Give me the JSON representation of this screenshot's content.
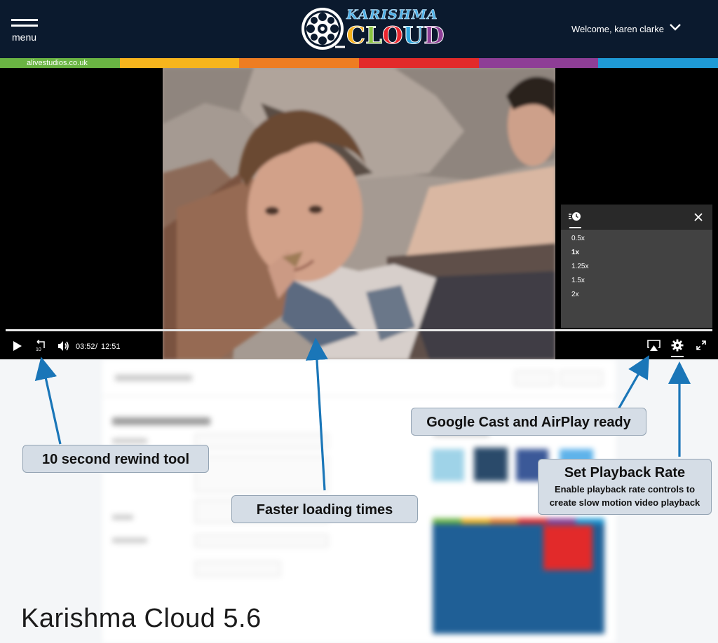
{
  "header": {
    "menu_label": "menu",
    "logo_top": "KARISHMA",
    "logo_bottom": [
      "C",
      "L",
      "O",
      "U",
      "D"
    ],
    "welcome": "Welcome, karen clarke",
    "bg_color": "#0b1a2e"
  },
  "strip": {
    "link": "alivestudios.co.uk",
    "colors": [
      "#6ab443",
      "#f7b51d",
      "#ee7d22",
      "#e22a2a",
      "#8e3e96",
      "#1f9ad6"
    ]
  },
  "player": {
    "current_time": "03:52",
    "time_separator": "/",
    "duration": "12:51",
    "rate_options": [
      "0.5x",
      "1x",
      "1.25x",
      "1.5x",
      "2x"
    ],
    "selected_rate": "1x",
    "icons": [
      "play-icon",
      "rewind-10-icon",
      "volume-icon",
      "airplay-icon",
      "settings-gear-icon",
      "fullscreen-icon",
      "playback-rate-icon",
      "close-icon"
    ]
  },
  "callouts": {
    "rewind": "10 second rewind tool",
    "loading": "Faster loading times",
    "cast": "Google Cast and AirPlay ready",
    "rate_title": "Set Playback Rate",
    "rate_desc_1": "Enable playback rate controls to",
    "rate_desc_2": "create slow motion video playback"
  },
  "version": "Karishma Cloud 5.6"
}
